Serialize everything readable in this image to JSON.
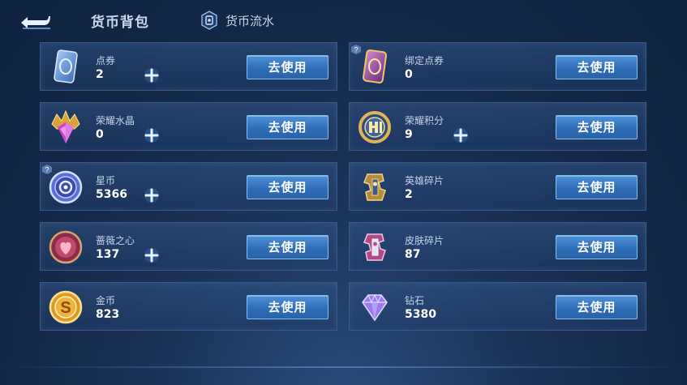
{
  "header": {
    "title": "货币背包",
    "flow_label": "货币流水"
  },
  "use_label": "去使用",
  "currencies": [
    {
      "name": "点券",
      "amount": "2",
      "icon": "voucher-card-icon",
      "plus": true
    },
    {
      "name": "绑定点券",
      "amount": "0",
      "icon": "bound-voucher-card-icon",
      "plus": false,
      "badge": true
    },
    {
      "name": "荣耀水晶",
      "amount": "0",
      "icon": "glory-crystal-icon",
      "plus": true
    },
    {
      "name": "荣耀积分",
      "amount": "9",
      "icon": "glory-points-icon",
      "plus": true
    },
    {
      "name": "星币",
      "amount": "5366",
      "icon": "star-coin-icon",
      "plus": true,
      "badge": true
    },
    {
      "name": "英雄碎片",
      "amount": "2",
      "icon": "hero-fragment-icon",
      "plus": false
    },
    {
      "name": "蔷薇之心",
      "amount": "137",
      "icon": "rose-heart-icon",
      "plus": true
    },
    {
      "name": "皮肤碎片",
      "amount": "87",
      "icon": "skin-fragment-icon",
      "plus": false
    },
    {
      "name": "金币",
      "amount": "823",
      "icon": "gold-coin-icon",
      "plus": false
    },
    {
      "name": "钻石",
      "amount": "5380",
      "icon": "diamond-icon",
      "plus": false
    }
  ],
  "colors": {
    "background": "#132846",
    "card_border": "#39597f",
    "button": "#2f6db8"
  }
}
